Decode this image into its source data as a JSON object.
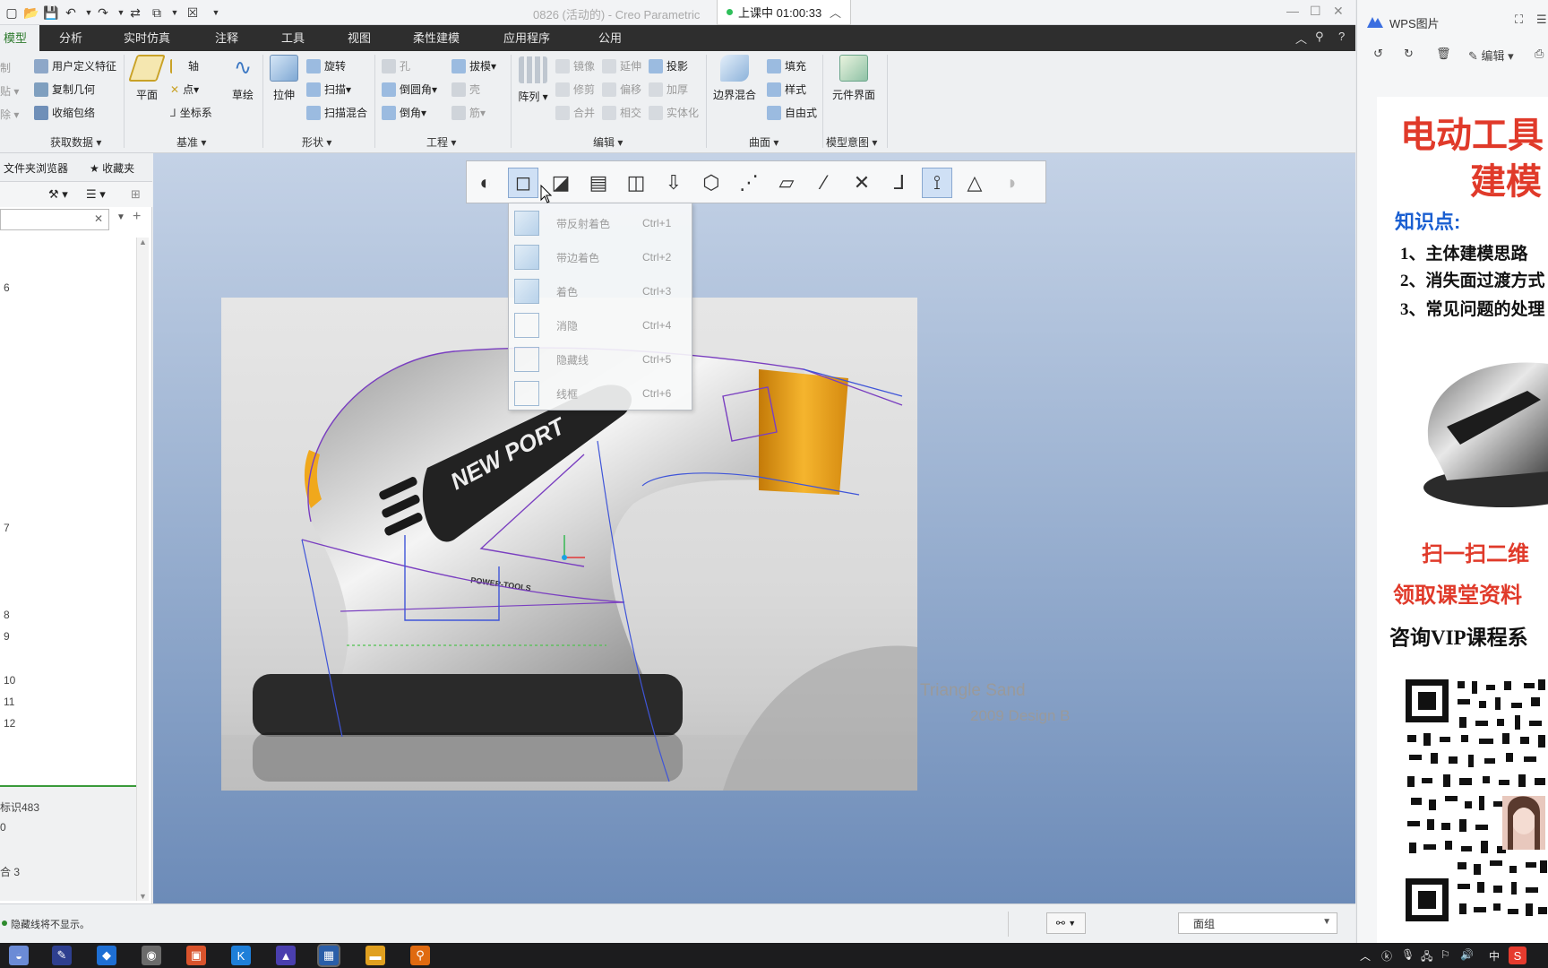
{
  "window": {
    "title": "0826 (活动的) - Creo Parametric",
    "timer_label": "上课中 01:00:33"
  },
  "tabs": [
    {
      "label": "模型"
    },
    {
      "label": "分析"
    },
    {
      "label": "实时仿真"
    },
    {
      "label": "注释"
    },
    {
      "label": "工具"
    },
    {
      "label": "视图"
    },
    {
      "label": "柔性建模"
    },
    {
      "label": "应用程序"
    },
    {
      "label": "公用"
    }
  ],
  "ribbon": {
    "get_data": {
      "items": [
        "用户定义特征",
        "复制几何",
        "收缩包络"
      ],
      "group": "获取数据"
    },
    "datum": {
      "plane": "平面",
      "axis": "轴",
      "point": "点",
      "csys": "坐标系",
      "sketch": "草绘",
      "group": "基准"
    },
    "shapes": {
      "extrude": "拉伸",
      "revolve": "旋转",
      "sweep": "扫描",
      "swept_blend": "扫描混合",
      "group": "形状"
    },
    "engineering": {
      "hole": "孔",
      "round": "倒圆角",
      "chamfer": "倒角",
      "draft": "拔模",
      "shell": "壳",
      "rib": "筋",
      "group": "工程"
    },
    "editing": {
      "pattern": "阵列",
      "mirror": "镜像",
      "trim": "修剪",
      "merge": "合并",
      "extend": "延伸",
      "offset": "偏移",
      "intersect": "相交",
      "project": "投影",
      "thicken": "加厚",
      "solidify": "实体化",
      "group": "编辑"
    },
    "surfaces": {
      "boundary_blend": "边界混合",
      "fill": "填充",
      "style": "样式",
      "freestyle": "自由式",
      "group": "曲面"
    },
    "model_intent": {
      "component_interface": "元件界面",
      "group": "模型意图"
    }
  },
  "left_panel": {
    "tab_folder_browser": "文件夹浏览器",
    "tab_favorites": "收藏夹",
    "tree_items": [
      "6",
      "7",
      "8",
      "9",
      "10",
      "11",
      "12"
    ],
    "footer_items": [
      "标识483",
      "0",
      "",
      "合 3"
    ]
  },
  "display_style_menu": [
    {
      "label": "带反射着色",
      "shortcut": "Ctrl+1"
    },
    {
      "label": "带边着色",
      "shortcut": "Ctrl+2"
    },
    {
      "label": "着色",
      "shortcut": "Ctrl+3"
    },
    {
      "label": "消隐",
      "shortcut": "Ctrl+4"
    },
    {
      "label": "隐藏线",
      "shortcut": "Ctrl+5"
    },
    {
      "label": "线框",
      "shortcut": "Ctrl+6"
    }
  ],
  "reference_image": {
    "brand_text": "NEW PORT",
    "brand_sub": "POWER-TOOLS",
    "caption_1": "Triangle Sand",
    "caption_2": "2009 Design B"
  },
  "status": {
    "message": "隐藏线将不显示。",
    "selection_filter": "面组"
  },
  "wps": {
    "title": "WPS图片",
    "edit_label": "编辑",
    "poster_title_1": "电动工具",
    "poster_title_2": "建模",
    "knowledge_label": "知识点:",
    "points": [
      "1、主体建模思路",
      "2、消失面过渡方式",
      "3、常见问题的处理"
    ],
    "scan_1": "扫一扫二维",
    "scan_2": "领取课堂资料",
    "vip": "咨询VIP课程系"
  },
  "taskbar": {
    "tray_ime": "中"
  },
  "colors": {
    "accent_green": "#2d7a2d",
    "poster_red": "#e03a2a",
    "poster_blue": "#1a5fd1",
    "viewport_top": "#c4d2e6",
    "viewport_bottom": "#6c8bb8"
  }
}
